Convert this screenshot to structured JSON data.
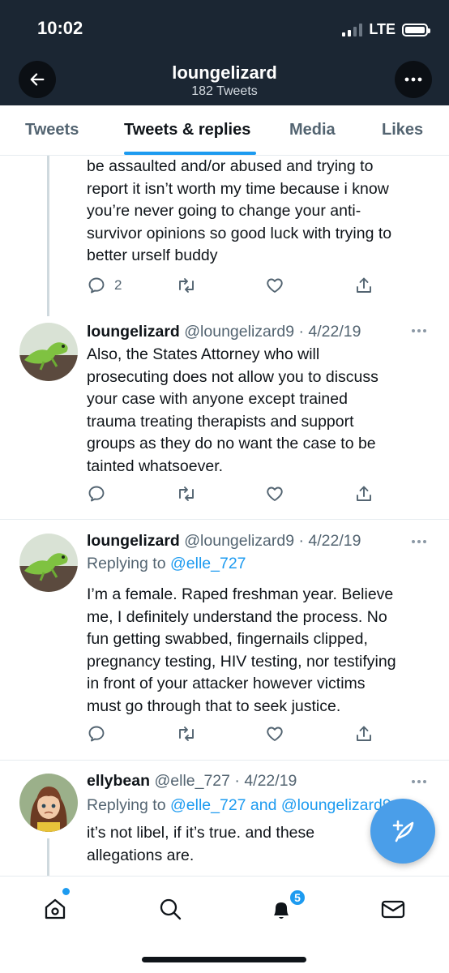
{
  "status_bar": {
    "time": "10:02",
    "network": "LTE"
  },
  "header": {
    "title": "loungelizard",
    "subtitle": "182 Tweets"
  },
  "tabs": [
    {
      "label": "Tweets",
      "active": false
    },
    {
      "label": "Tweets & replies",
      "active": true
    },
    {
      "label": "Media",
      "active": false
    },
    {
      "label": "Likes",
      "active": false
    }
  ],
  "tweets": [
    {
      "lines": [
        "be assaulted and/or abused and trying to",
        "report it isn’t worth my time because i know",
        "you’re never going to change your anti-",
        "survivor opinions so good luck with trying to",
        "better urself buddy"
      ],
      "reply_count": "2"
    },
    {
      "name": "loungelizard",
      "handle_date": "@loungelizard9 · 4/22/19",
      "lines": [
        "Also, the States Attorney who will",
        "prosecuting does not allow you to discuss",
        "your case with anyone except trained",
        "trauma treating therapists and support",
        "groups as they do no want the case to be",
        "tainted whatsoever."
      ]
    },
    {
      "name": "loungelizard",
      "handle_date": "@loungelizard9 · 4/22/19",
      "replying_prefix": "Replying to",
      "replying_to": "@elle_727",
      "lines": [
        "I’m a female. Raped freshman year. Believe",
        "me, I definitely understand the process. No",
        "fun getting swabbed, fingernails clipped,",
        "pregnancy testing, HIV testing, nor testifying",
        "in front of your attacker however victims",
        "must go through that to seek justice."
      ]
    },
    {
      "name": "ellybean",
      "handle_date": "@elle_727 · 4/22/19",
      "replying_prefix": "Replying to",
      "replying_to": "@elle_727 and @loungelizard9",
      "lines": [
        "it’s not libel, if it’s true. and these",
        "allegations are."
      ]
    }
  ],
  "bottom_nav": {
    "notifications_badge": "5"
  },
  "colors": {
    "header_bg": "#1b2633",
    "accent": "#1d9bf0",
    "fab": "#4a9ee9"
  }
}
